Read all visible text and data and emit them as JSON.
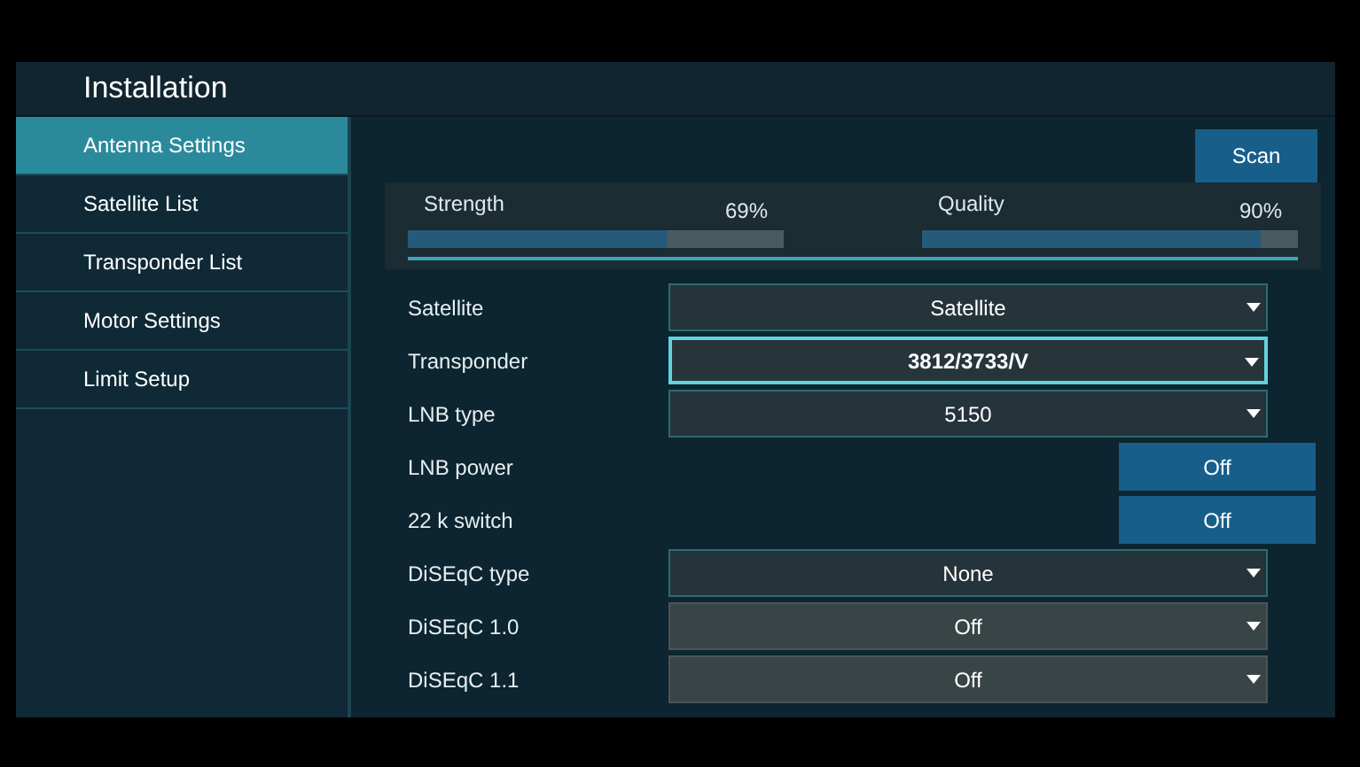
{
  "header": {
    "title": "Installation"
  },
  "sidebar": {
    "items": [
      {
        "label": "Antenna Settings",
        "selected": true
      },
      {
        "label": "Satellite List",
        "selected": false
      },
      {
        "label": "Transponder List",
        "selected": false
      },
      {
        "label": "Motor Settings",
        "selected": false
      },
      {
        "label": "Limit Setup",
        "selected": false
      }
    ]
  },
  "scan_button": "Scan",
  "meters": [
    {
      "label": "Strength",
      "reading": "69%",
      "level": 0.69
    },
    {
      "label": "Quality",
      "reading": "90%",
      "level": 0.9
    }
  ],
  "settings": [
    {
      "kind": "dropdown",
      "label": "Satellite",
      "value": "Satellite",
      "focused": false,
      "disabled": false
    },
    {
      "kind": "dropdown",
      "label": "Transponder",
      "value": "3812/3733/V",
      "focused": true,
      "disabled": false
    },
    {
      "kind": "dropdown",
      "label": "LNB type",
      "value": "5150",
      "focused": false,
      "disabled": false
    },
    {
      "kind": "toggle",
      "label": "LNB power",
      "value": "Off"
    },
    {
      "kind": "toggle",
      "label": "22 k switch",
      "value": "Off"
    },
    {
      "kind": "dropdown",
      "label": "DiSEqC type",
      "value": "None",
      "focused": false,
      "disabled": false
    },
    {
      "kind": "dropdown",
      "label": "DiSEqC 1.0",
      "value": "Off",
      "focused": false,
      "disabled": true
    },
    {
      "kind": "dropdown",
      "label": "DiSEqC 1.1",
      "value": "Off",
      "focused": false,
      "disabled": true
    }
  ]
}
